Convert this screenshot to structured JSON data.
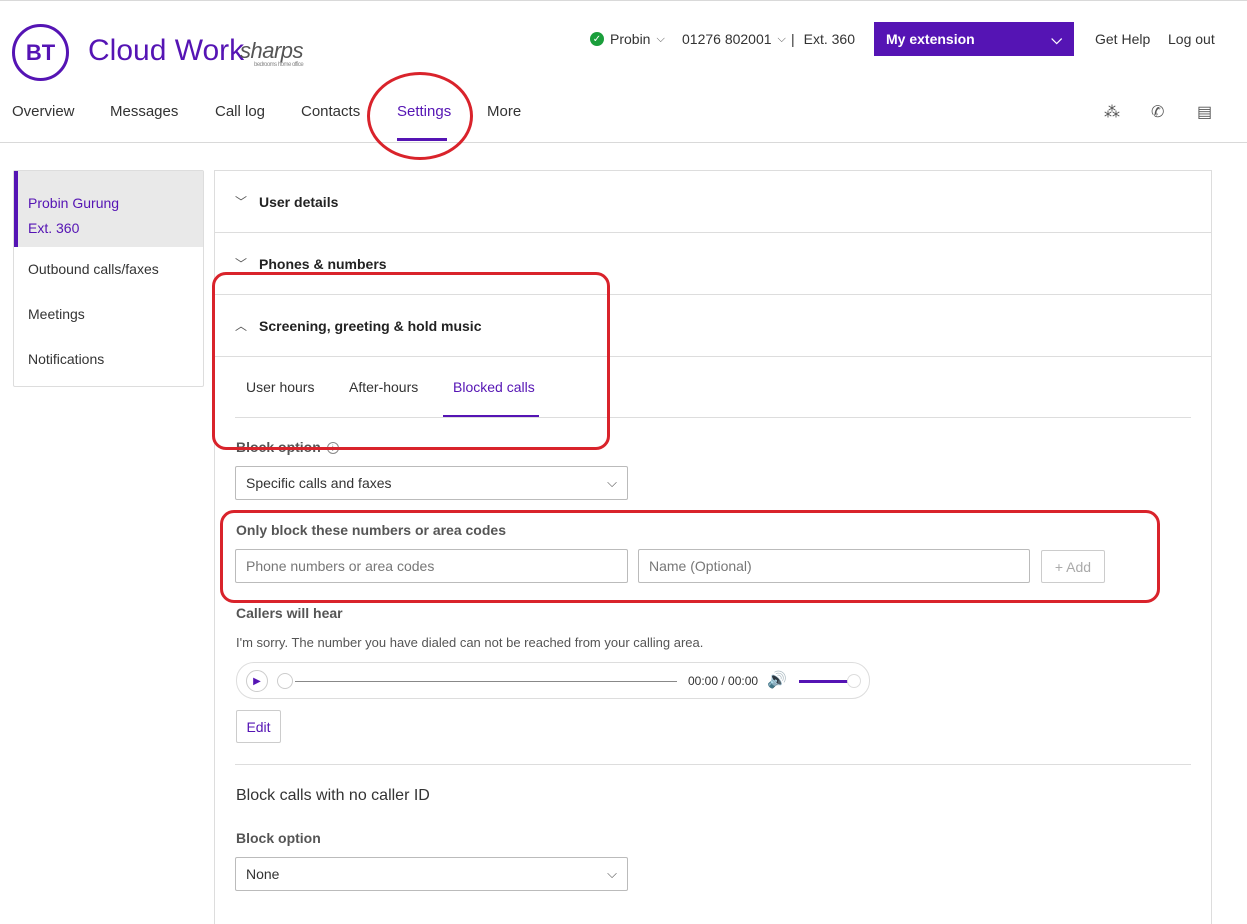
{
  "header": {
    "brand_logo_text": "BT",
    "brand_name": "Cloud Work",
    "partner_name": "sharps",
    "partner_tagline": "bedrooms home office",
    "status_user": "Probin",
    "phone_number": "01276 802001",
    "separator": "|",
    "extension": "Ext. 360",
    "my_extension_label": "My extension",
    "get_help": "Get Help",
    "log_out": "Log out",
    "status_color": "#1a9e3b"
  },
  "nav": {
    "items": [
      "Overview",
      "Messages",
      "Call log",
      "Contacts",
      "Settings",
      "More"
    ],
    "active": "Settings",
    "icons": [
      "people-icon",
      "phone-icon",
      "notes-icon"
    ]
  },
  "sidebar": {
    "user_name": "Probin Gurung",
    "user_ext": "Ext. 360",
    "items": [
      "Outbound calls/faxes",
      "Meetings",
      "Notifications"
    ]
  },
  "main": {
    "accordions": [
      {
        "title": "User details",
        "expanded": false
      },
      {
        "title": "Phones & numbers",
        "expanded": false
      },
      {
        "title": "Screening, greeting & hold music",
        "expanded": true
      }
    ],
    "tabs": [
      "User hours",
      "After-hours",
      "Blocked calls"
    ],
    "active_tab": "Blocked calls",
    "block_option_label": "Block option",
    "block_option_value": "Specific calls and faxes",
    "only_block_label": "Only block these numbers or area codes",
    "phone_placeholder": "Phone numbers or area codes",
    "name_placeholder": "Name (Optional)",
    "add_label": "+ Add",
    "callers_hear_label": "Callers will hear",
    "callers_hear_text": "I'm sorry. The number you have dialed can not be reached from your calling area.",
    "player_time": "00:00 / 00:00",
    "edit_label": "Edit",
    "no_caller_id_title": "Block calls with no caller ID",
    "no_caller_block_label": "Block option",
    "no_caller_block_value": "None"
  },
  "colors": {
    "accent": "#5514b4",
    "annotation": "#d9232b"
  }
}
